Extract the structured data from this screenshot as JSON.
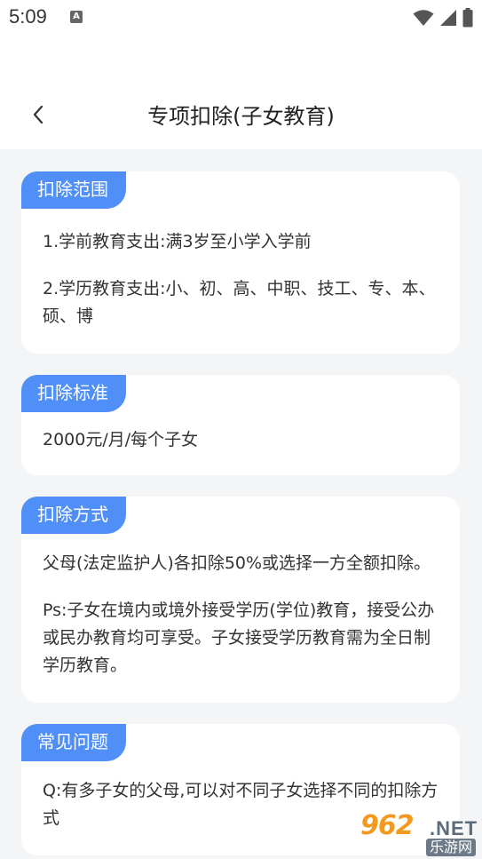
{
  "status_bar": {
    "time": "5:09",
    "notification_icon": "a-letter-icon",
    "wifi_icon": "wifi-icon",
    "signal_icon": "cell-signal-icon",
    "battery_icon": "battery-icon"
  },
  "header": {
    "back_icon": "chevron-left-icon",
    "title": "专项扣除(子女教育)"
  },
  "colors": {
    "accent": "#4f8ff7",
    "background": "#f4f5f7",
    "card": "#ffffff"
  },
  "sections": {
    "range": {
      "tag": "扣除范围",
      "items": [
        "1.学前教育支出:满3岁至小学入学前",
        "2.学历教育支出:小、初、高、中职、技工、专、本、硕、博"
      ]
    },
    "standard": {
      "tag": "扣除标准",
      "items": [
        "2000元/月/每个子女"
      ]
    },
    "method": {
      "tag": "扣除方式",
      "items": [
        "父母(法定监护人)各扣除50%或选择一方全额扣除。",
        "Ps:子女在境内或境外接受学历(学位)教育，接受公办或民办教育均可享受。子女接受学历教育需为全日制学历教育。"
      ]
    },
    "faq": {
      "tag": "常见问题",
      "items": [
        "Q:有多子女的父母,可以对不同子女选择不同的扣除方式"
      ]
    }
  },
  "watermark": {
    "number": "962",
    "domain": ".NET",
    "site": "乐游网"
  }
}
